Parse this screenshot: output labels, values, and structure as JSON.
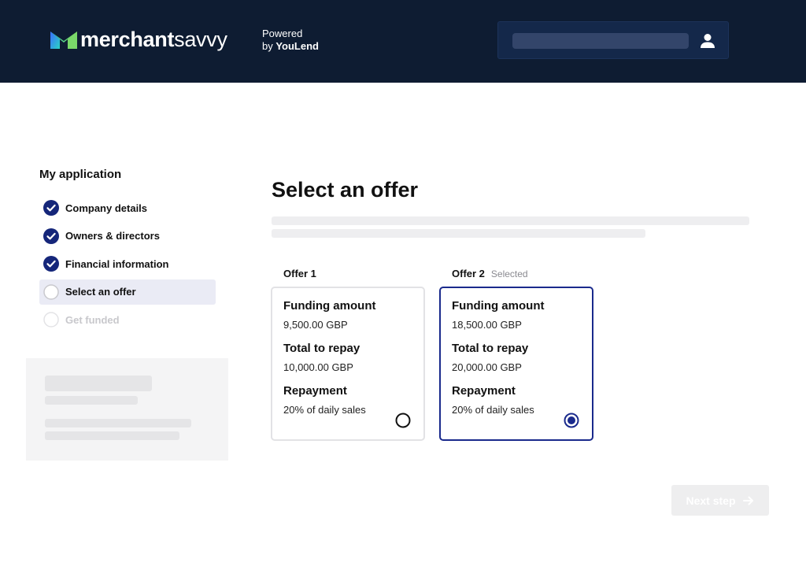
{
  "header": {
    "brand_bold": "merchant",
    "brand_light": "savvy",
    "powered_line1": "Powered",
    "powered_line2_prefix": "by ",
    "powered_line2_brand": "YouLend",
    "account_icon": "user-icon",
    "background": "#0e1c32"
  },
  "sidebar": {
    "title": "My application",
    "steps": [
      {
        "label": "Company details",
        "status": "complete",
        "icon": "check-circle-icon"
      },
      {
        "label": "Owners & directors",
        "status": "complete",
        "icon": "check-circle-icon"
      },
      {
        "label": "Financial information",
        "status": "complete",
        "icon": "check-circle-icon"
      },
      {
        "label": "Select an offer",
        "status": "current",
        "icon": "empty-circle-icon"
      },
      {
        "label": "Get funded",
        "status": "upcoming",
        "icon": "empty-circle-icon"
      }
    ]
  },
  "main": {
    "title": "Select an offer",
    "offers": [
      {
        "name": "Offer 1",
        "selected_label": "",
        "funding_heading": "Funding amount",
        "funding_value": "9,500.00 GBP",
        "repay_heading": "Total to repay",
        "repay_value": "10,000.00 GBP",
        "repayment_heading": "Repayment",
        "repayment_value": "20% of daily sales",
        "selected": false
      },
      {
        "name": "Offer 2",
        "selected_label": "Selected",
        "funding_heading": "Funding amount",
        "funding_value": "18,500.00 GBP",
        "repay_heading": "Total to repay",
        "repay_value": "20,000.00 GBP",
        "repayment_heading": "Repayment",
        "repayment_value": "20% of daily sales",
        "selected": true
      }
    ],
    "next_button": {
      "label": "Next step",
      "icon": "arrow-right-icon",
      "enabled": false
    }
  },
  "colors": {
    "accent": "#1a2a8c",
    "check": "#15267a",
    "header_bg": "#0e1c32"
  }
}
